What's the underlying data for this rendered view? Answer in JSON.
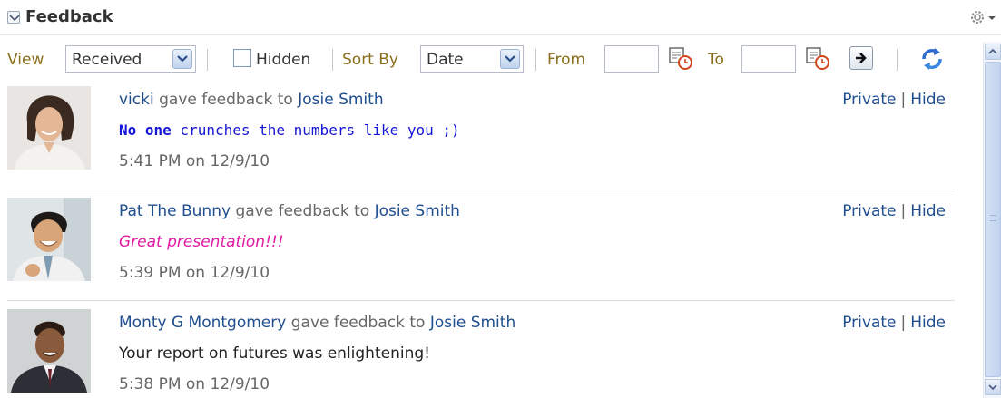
{
  "header": {
    "title": "Feedback",
    "collapse_icon": "chevron-down-icon",
    "menu_icon": "gear-icon"
  },
  "toolbar": {
    "view_label": "View",
    "view_value": "Received",
    "hidden_label": "Hidden",
    "hidden_checked": false,
    "sort_label": "Sort By",
    "sort_value": "Date",
    "from_label": "From",
    "from_value": "",
    "to_label": "To",
    "to_value": "",
    "calendar_icon": "calendar-icon",
    "go_icon": "arrow-right-icon",
    "refresh_icon": "refresh-icon"
  },
  "feedback": [
    {
      "from": "vicki",
      "action": " gave feedback to ",
      "to": "Josie Smith",
      "message_bold": "No one",
      "message_rest": " crunches the numbers like you ;)",
      "time": "5:41 PM on 12/9/10",
      "private_label": "Private",
      "hide_label": "Hide",
      "separator": "|"
    },
    {
      "from": "Pat The Bunny",
      "action": " gave feedback to ",
      "to": "Josie Smith",
      "message": "Great presentation!!!",
      "time": "5:39 PM on 12/9/10",
      "private_label": "Private",
      "hide_label": "Hide",
      "separator": "|"
    },
    {
      "from": "Monty G Montgomery",
      "action": " gave feedback to ",
      "to": "Josie Smith",
      "message": "Your report on futures was enlightening!",
      "time": "5:38 PM on 12/9/10",
      "private_label": "Private",
      "hide_label": "Hide",
      "separator": "|"
    }
  ],
  "colors": {
    "link": "#1f4e8f",
    "toolbar_label": "#8a6d1a",
    "message_blue": "#1515d8",
    "message_pink": "#e21aa4"
  }
}
